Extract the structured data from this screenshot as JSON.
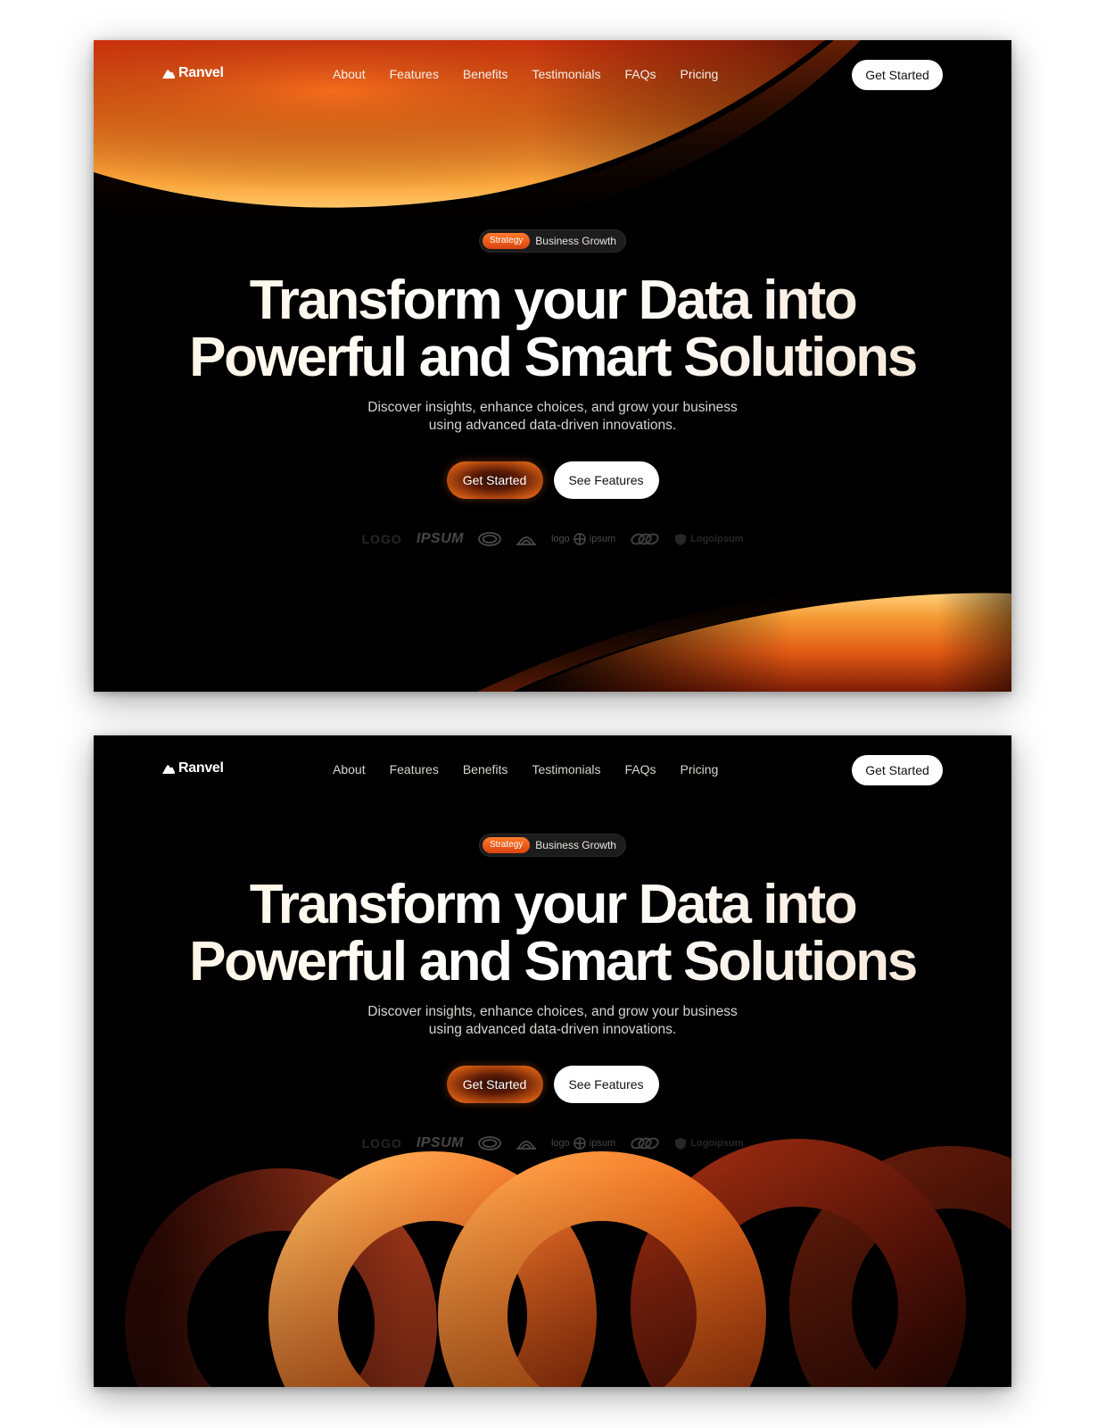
{
  "colors": {
    "accent": "#f07a1f",
    "accent_dark": "#c9360c",
    "background": "#000000",
    "text": "#f6efe4"
  },
  "boards": [
    {
      "nav": {
        "brand": "Ranvel",
        "links": [
          "About",
          "Features",
          "Benefits",
          "Testimonials",
          "FAQs",
          "Pricing"
        ],
        "cta": "Get Started"
      },
      "hero": {
        "badge_tag": "Strategy",
        "badge_text": "Business Growth",
        "headline_line1": "Transform your Data into",
        "headline_line2": "Powerful and Smart Solutions",
        "sub_line1": "Discover insights, enhance choices, and grow your business",
        "sub_line2": "using advanced data-driven innovations.",
        "primary_cta": "Get Started",
        "secondary_cta": "See Features"
      },
      "logos": {
        "logo1": "LOGO",
        "logo2": "IPSUM",
        "logo5_left": "logo",
        "logo5_right": "ipsum",
        "logo7": "Logoipsum"
      }
    },
    {
      "nav": {
        "brand": "Ranvel",
        "links": [
          "About",
          "Features",
          "Benefits",
          "Testimonials",
          "FAQs",
          "Pricing"
        ],
        "cta": "Get Started"
      },
      "hero": {
        "badge_tag": "Strategy",
        "badge_text": "Business Growth",
        "headline_line1": "Transform your Data into",
        "headline_line2": "Powerful and Smart Solutions",
        "sub_line1": "Discover insights, enhance choices, and grow your business",
        "sub_line2": "using advanced data-driven innovations.",
        "primary_cta": "Get Started",
        "secondary_cta": "See Features"
      },
      "logos": {
        "logo1": "LOGO",
        "logo2": "IPSUM",
        "logo5_left": "logo",
        "logo5_right": "ipsum",
        "logo7": "Logoipsum"
      }
    }
  ]
}
